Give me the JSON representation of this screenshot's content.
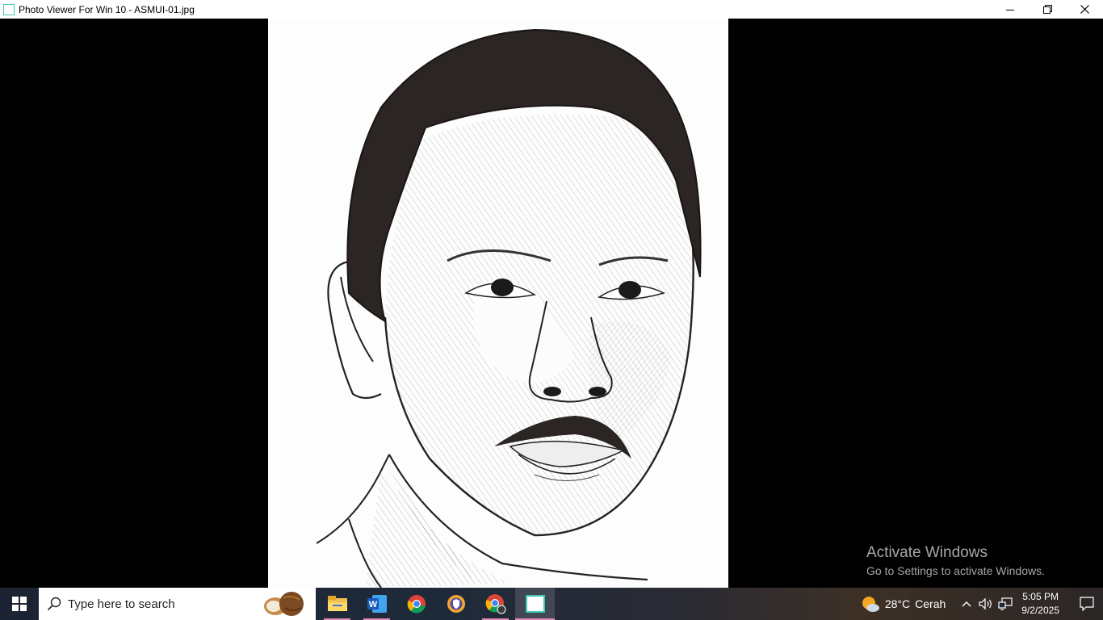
{
  "window": {
    "title": "Photo Viewer For Win 10 - ASMUI-01.jpg",
    "icons": {
      "app": "photo-viewer-icon",
      "minimize": "minimize-icon",
      "maximize": "restore-icon",
      "close": "close-icon"
    }
  },
  "watermark": {
    "title": "Activate Windows",
    "subtitle": "Go to Settings to activate Windows."
  },
  "taskbar": {
    "search_placeholder": "Type here to search",
    "apps": [
      {
        "icon": "file-explorer-icon",
        "open": true
      },
      {
        "icon": "word-icon",
        "open": true
      },
      {
        "icon": "chrome-icon",
        "open": false
      },
      {
        "icon": "vpn-shield-icon",
        "open": false
      },
      {
        "icon": "chrome-profile-icon",
        "open": true
      },
      {
        "icon": "photo-viewer-icon",
        "open": true,
        "active": true
      }
    ],
    "weather": {
      "temp": "28°C",
      "condition": "Cerah"
    },
    "clock": {
      "time": "5:05 PM",
      "date": "9/2/2025"
    }
  },
  "colors": {
    "accent": "#3fc7b6",
    "taskbar_indicator": "#e486b6"
  }
}
